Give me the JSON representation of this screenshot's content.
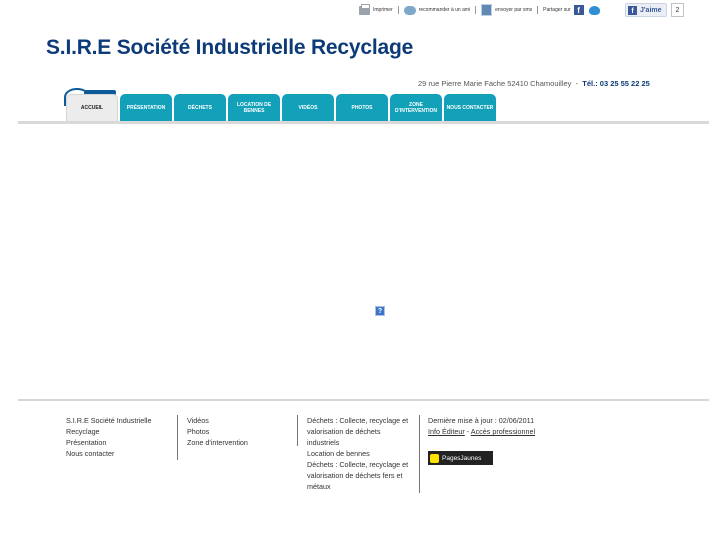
{
  "toolbar": {
    "print_label": "Imprimer",
    "recommend_label": "recommander à un ami",
    "send_label": "envoyer par sms",
    "share_label": "Partager sur",
    "like_label": "J'aime",
    "like_count": "2"
  },
  "header": {
    "title": "S.I.R.E Société Industrielle Recyclage",
    "address": "29 rue Pierre Marie Fache 52410 Chamouilley",
    "tel_label": "Tél.: 03 25 55 22 25"
  },
  "nav": {
    "tabs": [
      {
        "label": "ACCUEIL"
      },
      {
        "label": "PRÉSENTATION"
      },
      {
        "label": "DÉCHETS"
      },
      {
        "label": "LOCATION DE BENNES"
      },
      {
        "label": "VIDÉOS"
      },
      {
        "label": "PHOTOS"
      },
      {
        "label": "ZONE D'INTERVENTION"
      },
      {
        "label": "NOUS CONTACTER"
      }
    ]
  },
  "main": {
    "missing_plugin_icon": "?"
  },
  "footer": {
    "col1": [
      "S.I.R.E Société Industrielle Recyclage",
      "Présentation",
      "Nous contacter"
    ],
    "col2": [
      "Vidéos",
      "Photos",
      "Zone d'intervention"
    ],
    "col3": [
      "Déchets : Collecte, recyclage et valorisation de déchets industriels",
      "Location de bennes",
      "Déchets : Collecte, recyclage et valorisation de déchets fers et métaux"
    ],
    "last_update": "Dernière mise à jour : 02/06/2011",
    "info_editor": "Info Éditeur",
    "dash": "-",
    "pro_access": "Accès professionnel",
    "pagesjaunes_label": "PagesJaunes"
  },
  "colors": {
    "title": "#0d3a78",
    "nav_tab": "#12a1b8",
    "nav_active": "#ececec"
  },
  "icons": [
    "print-icon",
    "recommend-icon",
    "sms-icon",
    "facebook-icon",
    "twitter-icon",
    "help-icon",
    "pagesjaunes-icon"
  ]
}
